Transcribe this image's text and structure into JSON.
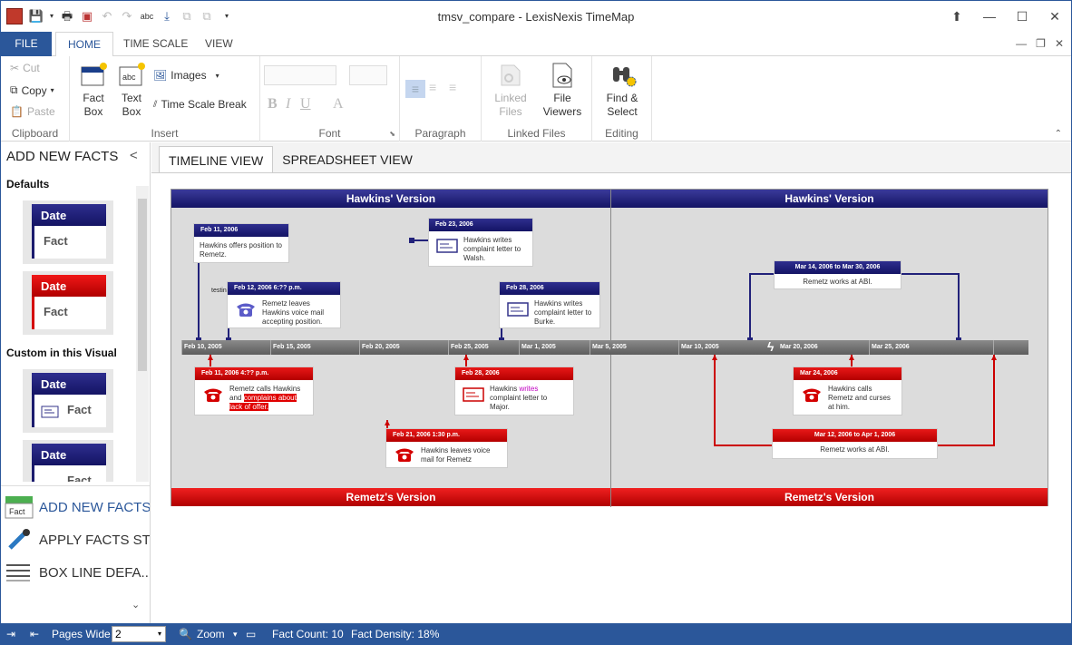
{
  "window": {
    "title": "tmsv_compare - LexisNexis TimeMap"
  },
  "ribbon_tabs": {
    "file": "FILE",
    "home": "HOME",
    "time_scale": "TIME SCALE",
    "view": "VIEW"
  },
  "clipboard": {
    "cut": "Cut",
    "copy": "Copy",
    "paste": "Paste",
    "label": "Clipboard"
  },
  "insert": {
    "fact_box": "Fact Box",
    "text_box": "Text Box",
    "images": "Images",
    "time_scale_break": "Time Scale Break",
    "label": "Insert"
  },
  "font": {
    "label": "Font"
  },
  "paragraph": {
    "label": "Paragraph"
  },
  "linked_files": {
    "linked_files": "Linked Files",
    "file_viewers": "File Viewers",
    "label": "Linked Files"
  },
  "editing": {
    "find_select": "Find & Select",
    "label": "Editing"
  },
  "left_panel": {
    "title": "ADD NEW FACTS",
    "defaults_label": "Defaults",
    "custom_label": "Custom in this Visual",
    "swatches": [
      {
        "date": "Date",
        "fact": "Fact"
      },
      {
        "date": "Date",
        "fact": "Fact"
      },
      {
        "date": "Date",
        "fact": "Fact"
      },
      {
        "date": "Date",
        "fact": "Fact"
      }
    ],
    "bottom_items": [
      "ADD NEW FACTS",
      "APPLY FACTS ST...",
      "BOX LINE DEFA..."
    ],
    "fact_icon_label": "Fact"
  },
  "doc_tabs": {
    "timeline": "TIMELINE VIEW",
    "spreadsheet": "SPREADSHEET VIEW"
  },
  "timeline": {
    "top_band_left": "Hawkins' Version",
    "top_band_right": "Hawkins' Version",
    "bottom_band_left": "Remetz's Version",
    "bottom_band_right": "Remetz's Version",
    "ticks": [
      "Feb 10, 2005",
      "Feb 15, 2005",
      "Feb 20, 2005",
      "Feb 25, 2005",
      "Mar 1, 2005",
      "Mar 5, 2005",
      "Mar 10, 2005",
      "Mar 20, 2006",
      "Mar 25, 2006"
    ],
    "stray_label": "testing",
    "cards": {
      "c1": {
        "date": "Feb 11, 2006",
        "text": "Hawkins offers position to Remetz."
      },
      "c2": {
        "date": "Feb 23, 2006",
        "text": "Hawkins writes complaint letter to Walsh."
      },
      "c3": {
        "date": "Feb 12, 2006 6:?? p.m.",
        "text": "Remetz leaves Hawkins voice mail accepting position."
      },
      "c4": {
        "date": "Feb 28, 2006",
        "text": "Hawkins writes complaint letter to Burke."
      },
      "c5": {
        "date": "Mar 14, 2006 to Mar 30, 2006",
        "text": "Remetz works at ABI."
      },
      "c6": {
        "date": "Feb 11, 2006 4:?? p.m.",
        "text_a": "Remetz calls Hawkins and ",
        "text_b": "complains about lack of offer."
      },
      "c7": {
        "date": "Feb 28, 2006",
        "text_a": "Hawkins ",
        "text_b": "writes",
        "text_c": " complaint letter to Major."
      },
      "c8": {
        "date": "Feb 21, 2006 1:30 p.m.",
        "text": "Hawkins leaves voice mail for Remetz"
      },
      "c9": {
        "date": "Mar 24, 2006",
        "text": "Hawkins calls Remetz and curses at him."
      },
      "c10": {
        "date": "Mar 12, 2006 to Apr 1, 2006",
        "text": "Remetz works at ABI."
      }
    }
  },
  "status": {
    "pages_wide_label": "Pages Wide",
    "pages_wide_value": "2",
    "zoom": "Zoom",
    "fact_count": "Fact Count: 10",
    "fact_density": "Fact Density: 18%"
  },
  "colors": {
    "accent": "#2b579a",
    "hawkins_blue": "#1b1b6e",
    "remetz_red": "#d40000"
  }
}
